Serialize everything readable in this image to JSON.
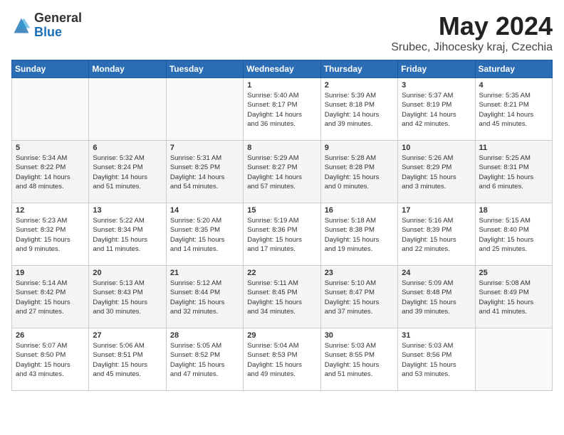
{
  "logo": {
    "general": "General",
    "blue": "Blue"
  },
  "title": "May 2024",
  "location": "Srubec, Jihocesky kraj, Czechia",
  "days_header": [
    "Sunday",
    "Monday",
    "Tuesday",
    "Wednesday",
    "Thursday",
    "Friday",
    "Saturday"
  ],
  "weeks": [
    [
      {
        "day": "",
        "info": ""
      },
      {
        "day": "",
        "info": ""
      },
      {
        "day": "",
        "info": ""
      },
      {
        "day": "1",
        "info": "Sunrise: 5:40 AM\nSunset: 8:17 PM\nDaylight: 14 hours\nand 36 minutes."
      },
      {
        "day": "2",
        "info": "Sunrise: 5:39 AM\nSunset: 8:18 PM\nDaylight: 14 hours\nand 39 minutes."
      },
      {
        "day": "3",
        "info": "Sunrise: 5:37 AM\nSunset: 8:19 PM\nDaylight: 14 hours\nand 42 minutes."
      },
      {
        "day": "4",
        "info": "Sunrise: 5:35 AM\nSunset: 8:21 PM\nDaylight: 14 hours\nand 45 minutes."
      }
    ],
    [
      {
        "day": "5",
        "info": "Sunrise: 5:34 AM\nSunset: 8:22 PM\nDaylight: 14 hours\nand 48 minutes."
      },
      {
        "day": "6",
        "info": "Sunrise: 5:32 AM\nSunset: 8:24 PM\nDaylight: 14 hours\nand 51 minutes."
      },
      {
        "day": "7",
        "info": "Sunrise: 5:31 AM\nSunset: 8:25 PM\nDaylight: 14 hours\nand 54 minutes."
      },
      {
        "day": "8",
        "info": "Sunrise: 5:29 AM\nSunset: 8:27 PM\nDaylight: 14 hours\nand 57 minutes."
      },
      {
        "day": "9",
        "info": "Sunrise: 5:28 AM\nSunset: 8:28 PM\nDaylight: 15 hours\nand 0 minutes."
      },
      {
        "day": "10",
        "info": "Sunrise: 5:26 AM\nSunset: 8:29 PM\nDaylight: 15 hours\nand 3 minutes."
      },
      {
        "day": "11",
        "info": "Sunrise: 5:25 AM\nSunset: 8:31 PM\nDaylight: 15 hours\nand 6 minutes."
      }
    ],
    [
      {
        "day": "12",
        "info": "Sunrise: 5:23 AM\nSunset: 8:32 PM\nDaylight: 15 hours\nand 9 minutes."
      },
      {
        "day": "13",
        "info": "Sunrise: 5:22 AM\nSunset: 8:34 PM\nDaylight: 15 hours\nand 11 minutes."
      },
      {
        "day": "14",
        "info": "Sunrise: 5:20 AM\nSunset: 8:35 PM\nDaylight: 15 hours\nand 14 minutes."
      },
      {
        "day": "15",
        "info": "Sunrise: 5:19 AM\nSunset: 8:36 PM\nDaylight: 15 hours\nand 17 minutes."
      },
      {
        "day": "16",
        "info": "Sunrise: 5:18 AM\nSunset: 8:38 PM\nDaylight: 15 hours\nand 19 minutes."
      },
      {
        "day": "17",
        "info": "Sunrise: 5:16 AM\nSunset: 8:39 PM\nDaylight: 15 hours\nand 22 minutes."
      },
      {
        "day": "18",
        "info": "Sunrise: 5:15 AM\nSunset: 8:40 PM\nDaylight: 15 hours\nand 25 minutes."
      }
    ],
    [
      {
        "day": "19",
        "info": "Sunrise: 5:14 AM\nSunset: 8:42 PM\nDaylight: 15 hours\nand 27 minutes."
      },
      {
        "day": "20",
        "info": "Sunrise: 5:13 AM\nSunset: 8:43 PM\nDaylight: 15 hours\nand 30 minutes."
      },
      {
        "day": "21",
        "info": "Sunrise: 5:12 AM\nSunset: 8:44 PM\nDaylight: 15 hours\nand 32 minutes."
      },
      {
        "day": "22",
        "info": "Sunrise: 5:11 AM\nSunset: 8:45 PM\nDaylight: 15 hours\nand 34 minutes."
      },
      {
        "day": "23",
        "info": "Sunrise: 5:10 AM\nSunset: 8:47 PM\nDaylight: 15 hours\nand 37 minutes."
      },
      {
        "day": "24",
        "info": "Sunrise: 5:09 AM\nSunset: 8:48 PM\nDaylight: 15 hours\nand 39 minutes."
      },
      {
        "day": "25",
        "info": "Sunrise: 5:08 AM\nSunset: 8:49 PM\nDaylight: 15 hours\nand 41 minutes."
      }
    ],
    [
      {
        "day": "26",
        "info": "Sunrise: 5:07 AM\nSunset: 8:50 PM\nDaylight: 15 hours\nand 43 minutes."
      },
      {
        "day": "27",
        "info": "Sunrise: 5:06 AM\nSunset: 8:51 PM\nDaylight: 15 hours\nand 45 minutes."
      },
      {
        "day": "28",
        "info": "Sunrise: 5:05 AM\nSunset: 8:52 PM\nDaylight: 15 hours\nand 47 minutes."
      },
      {
        "day": "29",
        "info": "Sunrise: 5:04 AM\nSunset: 8:53 PM\nDaylight: 15 hours\nand 49 minutes."
      },
      {
        "day": "30",
        "info": "Sunrise: 5:03 AM\nSunset: 8:55 PM\nDaylight: 15 hours\nand 51 minutes."
      },
      {
        "day": "31",
        "info": "Sunrise: 5:03 AM\nSunset: 8:56 PM\nDaylight: 15 hours\nand 53 minutes."
      },
      {
        "day": "",
        "info": ""
      }
    ]
  ]
}
